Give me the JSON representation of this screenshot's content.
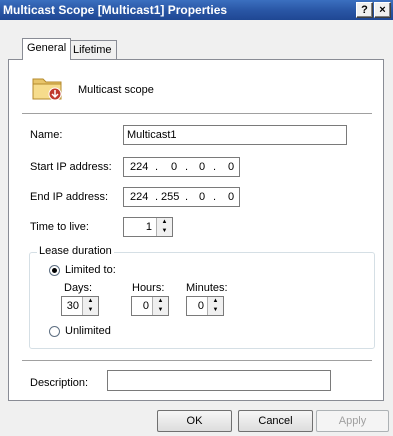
{
  "window": {
    "title": "Multicast Scope [Multicast1]  Properties",
    "help_label": "?",
    "close_label": "×"
  },
  "tabs": [
    {
      "label": "General",
      "selected": true
    },
    {
      "label": "Lifetime",
      "selected": false
    }
  ],
  "header": {
    "icon": "folder-multicast-icon",
    "label": "Multicast scope"
  },
  "fields": {
    "name_label": "Name:",
    "name_value": "Multicast1",
    "start_ip_label": "Start IP address:",
    "start_ip": [
      "224",
      "0",
      "0",
      "0"
    ],
    "end_ip_label": "End IP address:",
    "end_ip": [
      "224",
      "255",
      "0",
      "0"
    ],
    "ip_separator": ".",
    "ttl_label": "Time to live:",
    "ttl_value": "1"
  },
  "lease": {
    "group_label": "Lease duration",
    "limited_label": "Limited to:",
    "limited_checked": true,
    "days_label": "Days:",
    "days_value": "30",
    "hours_label": "Hours:",
    "hours_value": "0",
    "minutes_label": "Minutes:",
    "minutes_value": "0",
    "unlimited_label": "Unlimited",
    "unlimited_checked": false
  },
  "description": {
    "label": "Description:",
    "value": ""
  },
  "buttons": {
    "ok": "OK",
    "cancel": "Cancel",
    "apply": "Apply"
  },
  "colors": {
    "titlebar": "#2a57a6",
    "accent_icon": "#c0392b"
  }
}
